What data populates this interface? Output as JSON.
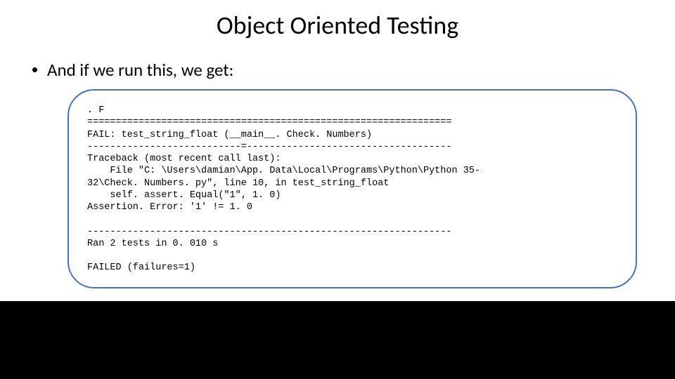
{
  "title": "Object Oriented Testing",
  "bullet": "And if we run this, we get:",
  "code": {
    "l01": ". F",
    "l02": "================================================================",
    "l03": "FAIL: test_string_float (__main__. Check. Numbers)",
    "l04": "---------------------------=------------------------------------",
    "l05": "Traceback (most recent call last):",
    "l06": "    File \"C: \\Users\\damian\\App. Data\\Local\\Programs\\Python\\Python 35-",
    "l07": "32\\Check. Numbers. py\", line 10, in test_string_float",
    "l08": "    self. assert. Equal(\"1\", 1. 0)",
    "l09": "Assertion. Error: '1' != 1. 0",
    "l10": "",
    "l11": "----------------------------------------------------------------",
    "l12": "Ran 2 tests in 0. 010 s",
    "l13": "",
    "l14": "FAILED (failures=1)"
  }
}
